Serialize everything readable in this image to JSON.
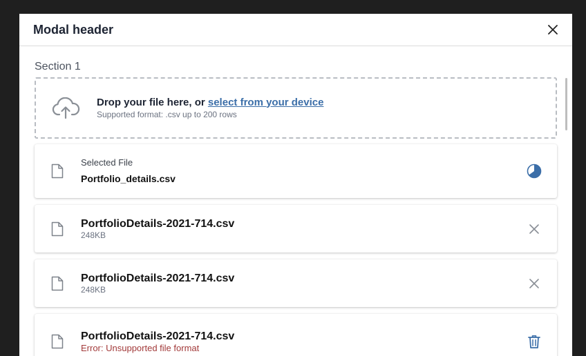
{
  "modal": {
    "title": "Modal header"
  },
  "section": {
    "title": "Section 1"
  },
  "dropzone": {
    "prompt": "Drop your file here, or",
    "link": "select from your device",
    "hint": "Supported format: .csv up to 200 rows"
  },
  "selected": {
    "label": "Selected File",
    "filename": "Portfolio_details.csv",
    "progress": 0.65
  },
  "files": [
    {
      "name": "PortfolioDetails-2021-714.csv",
      "size": "248KB"
    },
    {
      "name": "PortfolioDetails-2021-714.csv",
      "size": "248KB"
    },
    {
      "name": "PortfolioDetails-2021-714.csv",
      "error": "Error: Unsupported file format"
    }
  ],
  "colors": {
    "accent": "#3b6ea8",
    "error": "#a23a3a",
    "backdrop": "#1f1f1f"
  },
  "icons": {
    "close": "close-icon",
    "upload": "cloud-upload-icon",
    "file": "file-icon",
    "progress": "progress-pie-icon",
    "remove": "remove-x-icon",
    "delete": "trash-icon"
  }
}
